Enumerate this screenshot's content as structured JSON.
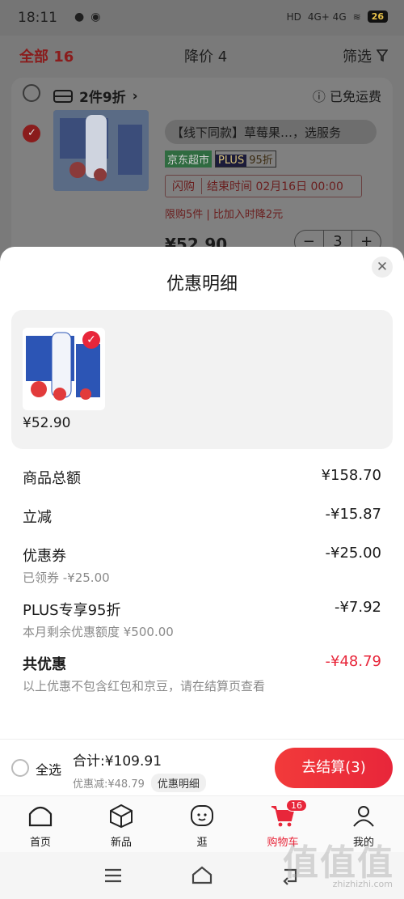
{
  "status": {
    "time": "18:11",
    "signal": "4G+ 4G",
    "battery": "26"
  },
  "header": {
    "all_label": "全部 16",
    "price_drop_label": "降价 4",
    "filter_label": "筛选"
  },
  "cart_item": {
    "promo": "2件9折",
    "shipping": "已免运费",
    "title": "【线下同款】草莓果…，选服务",
    "tag_store": "京东超市",
    "tag_plus": "PLUS",
    "tag_discount": "95折",
    "flash_label": "闪购",
    "flash_end": "结束时间 02月16日 00:00",
    "limit_text": "限购5件 | 比加入时降2元",
    "price": "¥52.90",
    "quantity": "3"
  },
  "sheet": {
    "title": "优惠明细",
    "product_price": "¥52.90",
    "rows": {
      "total_label": "商品总额",
      "total_value": "¥158.70",
      "instant_label": "立减",
      "instant_value": "-¥15.87",
      "coupon_label": "优惠券",
      "coupon_value": "-¥25.00",
      "coupon_sub": "已领券 -¥25.00",
      "plus_label": "PLUS专享95折",
      "plus_value": "-¥7.92",
      "plus_sub": "本月剩余优惠额度 ¥500.00",
      "sum_label": "共优惠",
      "sum_value": "-¥48.79",
      "note": "以上优惠不包含红包和京豆，请在结算页查看"
    }
  },
  "bottom": {
    "select_all": "全选",
    "total": "合计:¥109.91",
    "discount": "优惠减:¥48.79",
    "detail": "优惠明细",
    "checkout": "去结算(3)"
  },
  "tabbar": {
    "home": "首页",
    "new": "新品",
    "browse": "逛",
    "cart": "购物车",
    "cart_badge": "16",
    "mine": "我的"
  },
  "watermark": {
    "big": "值值值",
    "small": "zhizhizhi.com"
  },
  "colors": {
    "accent": "#e8263a",
    "dim_overlay": "#7a7a7a"
  }
}
